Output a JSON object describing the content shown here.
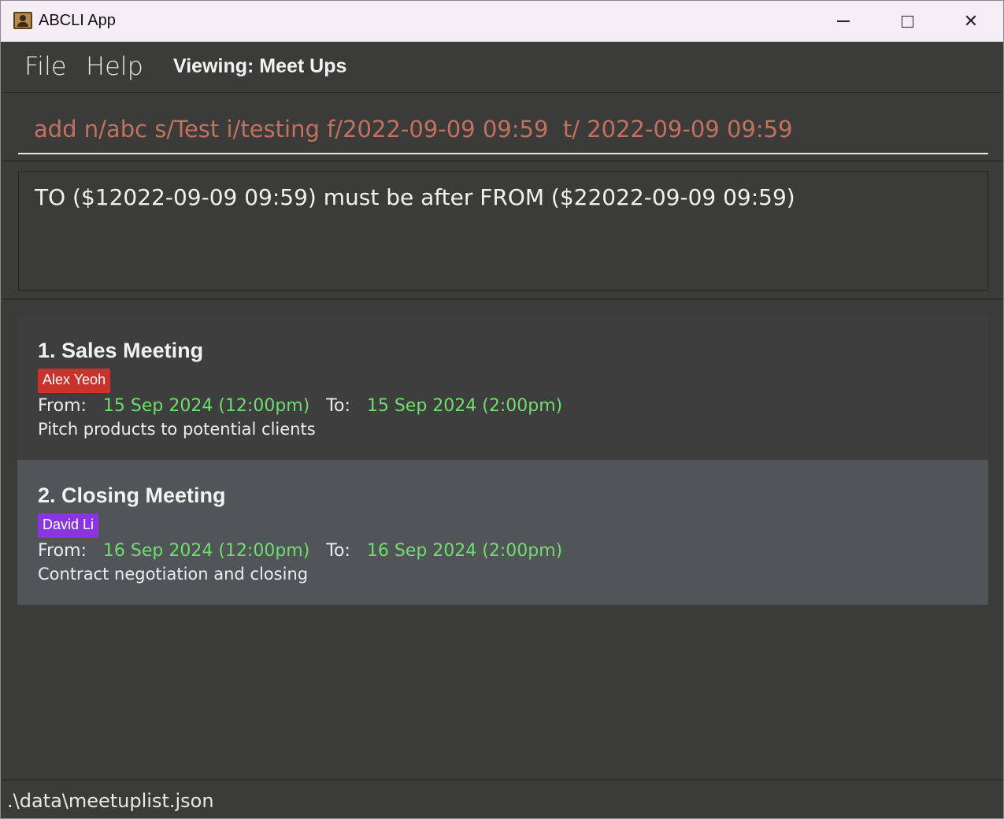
{
  "window": {
    "title": "ABCLI App"
  },
  "menu": {
    "file_label": "File",
    "help_label": "Help",
    "viewing_label": "Viewing: Meet Ups"
  },
  "command": {
    "value": "add n/abc s/Test i/testing f/2022-09-09 09:59  t/ 2022-09-09 09:59"
  },
  "result": {
    "message": "TO ($12022-09-09 09:59) must be after FROM ($22022-09-09 09:59)"
  },
  "meetups": [
    {
      "title": "1. Sales Meeting",
      "tag": "Alex Yeoh",
      "tag_color": "#c9332c",
      "from_label": "From:",
      "from": "15 Sep 2024 (12:00pm)",
      "to_label": "To:",
      "to": "15 Sep 2024 (2:00pm)",
      "description": "Pitch products to potential clients"
    },
    {
      "title": "2. Closing Meeting",
      "tag": "David Li",
      "tag_color": "#8a35df",
      "from_label": "From:",
      "from": "16 Sep 2024 (12:00pm)",
      "to_label": "To:",
      "to": "16 Sep 2024 (2:00pm)",
      "description": "Contract negotiation and closing"
    }
  ],
  "status": {
    "file_path": ".\\data\\meetuplist.json"
  },
  "colors": {
    "background": "#3b3b3a",
    "command_text": "#c4705f",
    "date_text": "#6fdc6f"
  }
}
